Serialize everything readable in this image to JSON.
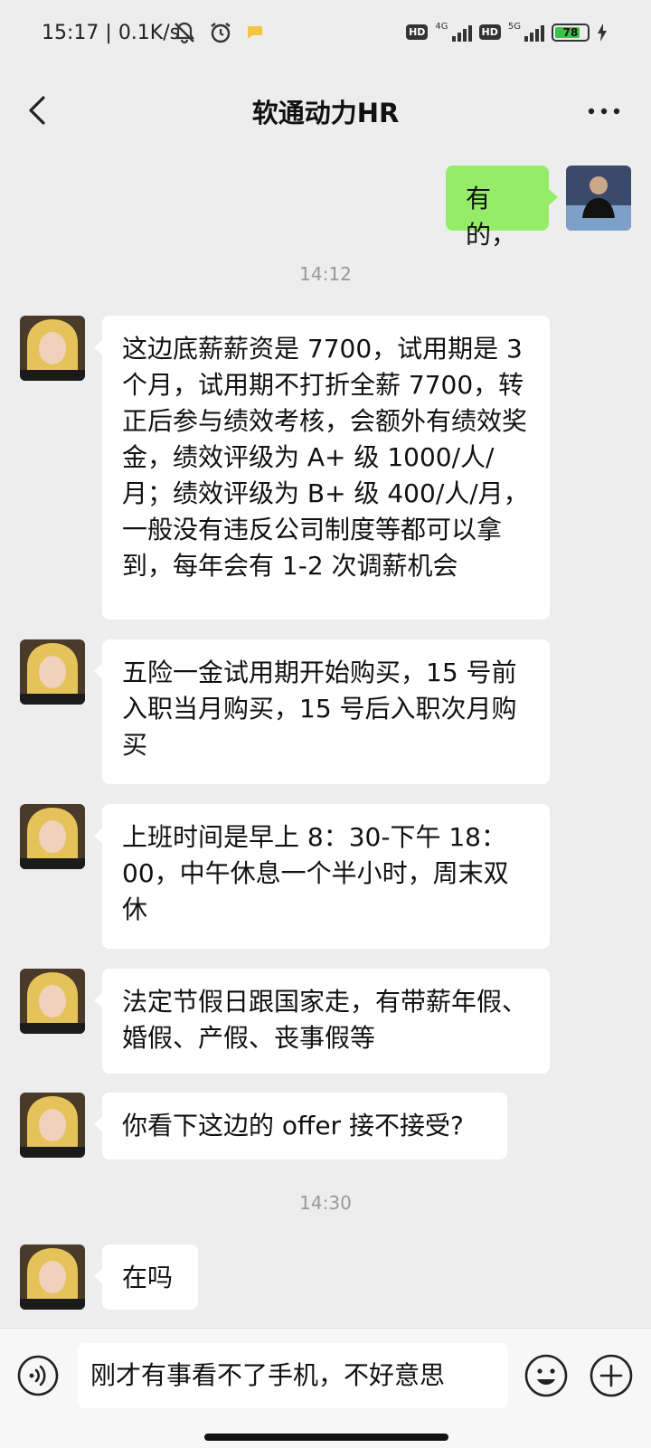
{
  "status_bar": {
    "time": "15:17",
    "net_speed": "0.1K/s",
    "sim1_hd": "HD",
    "sim1_gen": "4G",
    "sim2_hd": "HD",
    "sim2_gen": "5G",
    "battery": "78",
    "battery_level": 0.78,
    "battery_color": "#3cc24b"
  },
  "header": {
    "title": "软通动力HR"
  },
  "colors": {
    "outgoing_bubble": "#95ec69",
    "incoming_bubble": "#ffffff",
    "background": "#ededed"
  },
  "messages": {
    "out1": "有的，",
    "time1": "14:12",
    "in1": "这边底薪薪资是 7700，试用期是 3 个月，试用期不打折全薪 7700，转正后参与绩效考核，会额外有绩效奖金，绩效评级为 A+ 级 1000/人/月；绩效评级为 B+ 级 400/人/月，一般没有违反公司制度等都可以拿到，每年会有 1-2 次调薪机会",
    "in2": "五险一金试用期开始购买，15 号前入职当月购买，15 号后入职次月购买",
    "in3": "上班时间是早上 8：30-下午 18：00，中午休息一个半小时，周末双休",
    "in4": "法定节假日跟国家走，有带薪年假、婚假、产假、丧事假等",
    "in5": "你看下这边的 offer 接不接受?",
    "time2": "14:30",
    "in6": "在吗"
  },
  "input": {
    "value": "刚才有事看不了手机，不好意思"
  }
}
